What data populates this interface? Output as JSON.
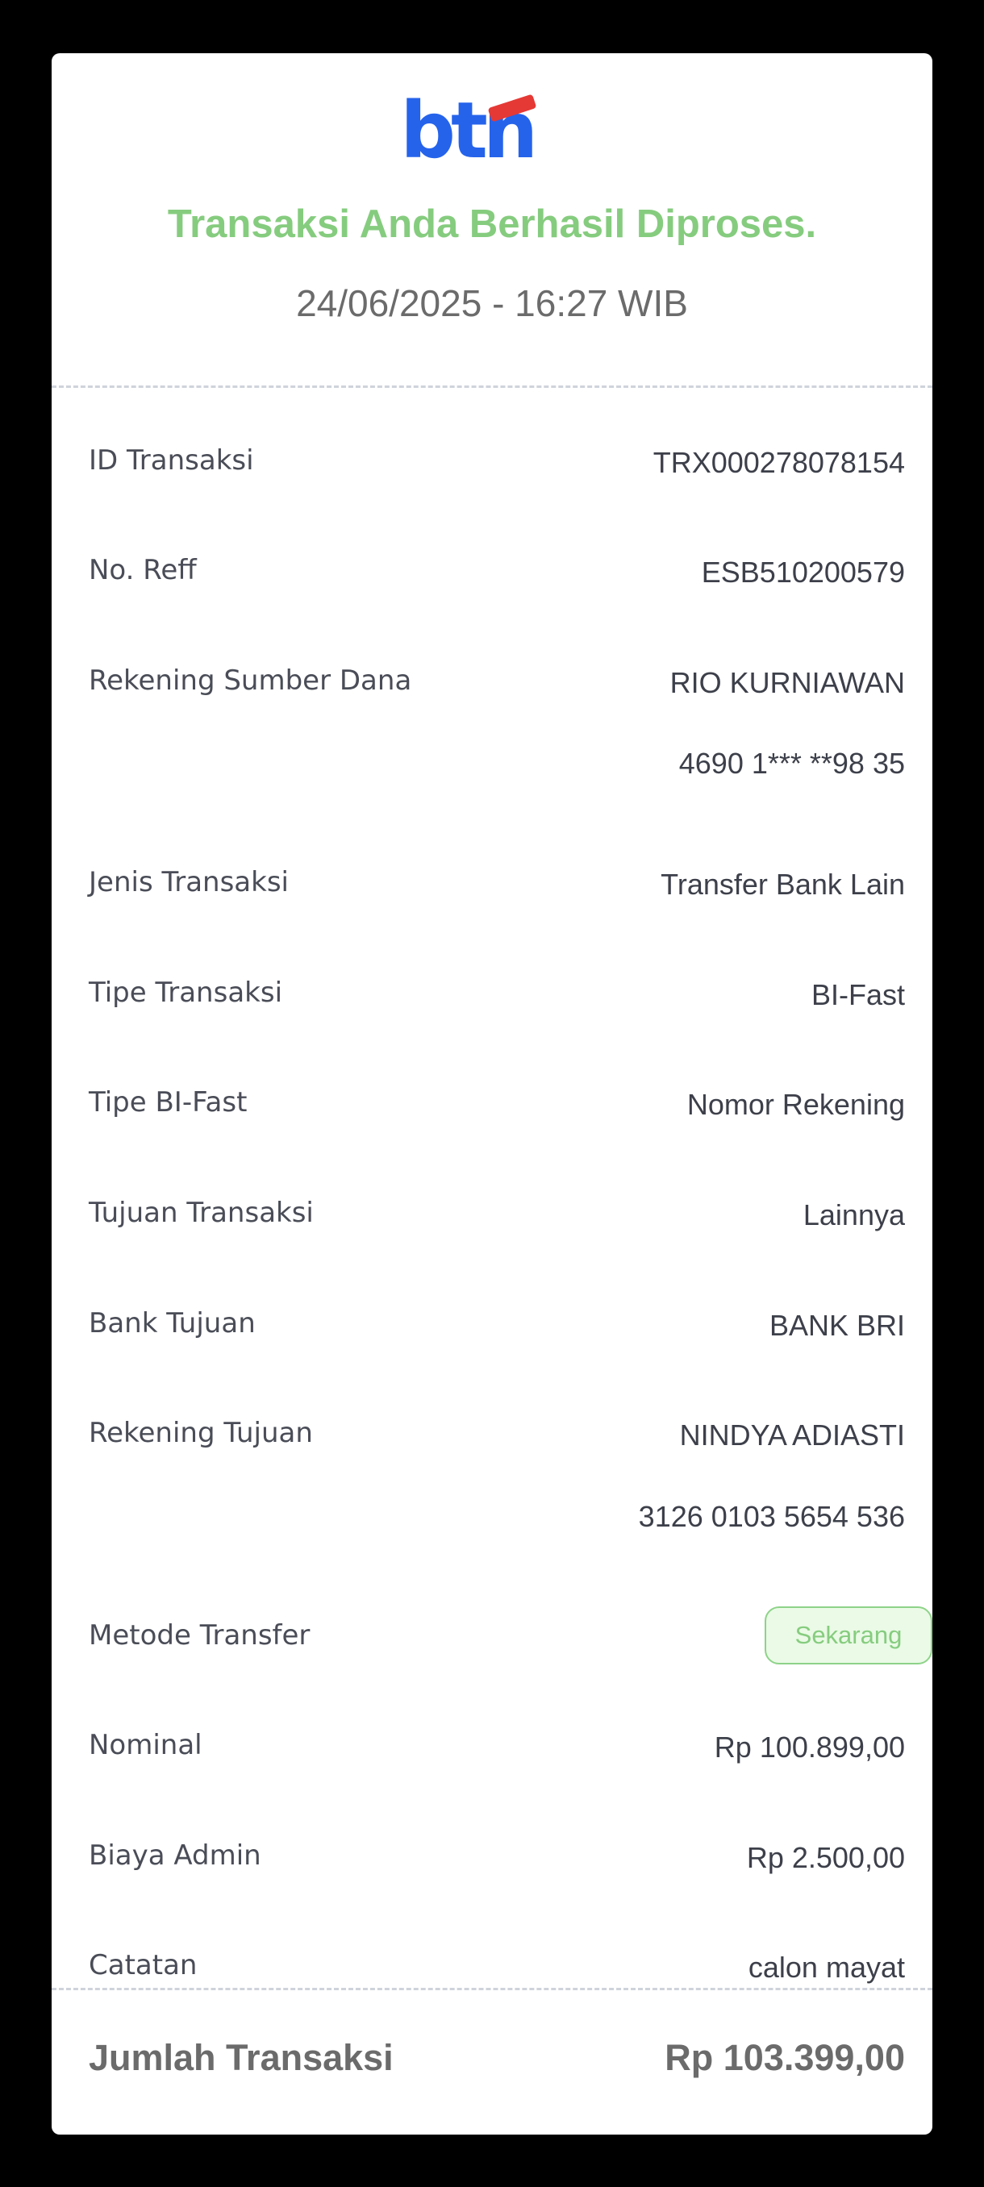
{
  "header": {
    "logo_text": "btn",
    "success_message": "Transaksi Anda Berhasil Diproses.",
    "datetime": "24/06/2025 - 16:27 WIB"
  },
  "details": {
    "transaction_id": {
      "label": "ID Transaksi",
      "value": "TRX000278078154"
    },
    "reference": {
      "label": "No. Reff",
      "value": "ESB510200579"
    },
    "source_account": {
      "label": "Rekening Sumber Dana",
      "name": "RIO KURNIAWAN",
      "number": "4690 1*** **98 35"
    },
    "transaction_kind": {
      "label": "Jenis Transaksi",
      "value": "Transfer Bank Lain"
    },
    "transaction_type": {
      "label": "Tipe Transaksi",
      "value": "BI-Fast"
    },
    "bifast_type": {
      "label": "Tipe BI-Fast",
      "value": "Nomor Rekening"
    },
    "purpose": {
      "label": "Tujuan Transaksi",
      "value": "Lainnya"
    },
    "destination_bank": {
      "label": "Bank Tujuan",
      "value": "BANK BRI"
    },
    "destination_account": {
      "label": "Rekening Tujuan",
      "name": "NINDYA ADIASTI",
      "number": "3126 0103 5654 536"
    },
    "transfer_method": {
      "label": "Metode Transfer",
      "value": "Sekarang"
    },
    "nominal": {
      "label": "Nominal",
      "value": "Rp 100.899,00"
    },
    "admin_fee": {
      "label": "Biaya Admin",
      "value": "Rp 2.500,00"
    },
    "note": {
      "label": "Catatan",
      "value": "calon mayat"
    }
  },
  "total": {
    "label": "Jumlah Transaksi",
    "value": "Rp 103.399,00"
  },
  "colors": {
    "brand_blue": "#2563eb",
    "brand_red": "#e53935",
    "success_green": "#86cc7f",
    "badge_bg": "#eafae6"
  }
}
